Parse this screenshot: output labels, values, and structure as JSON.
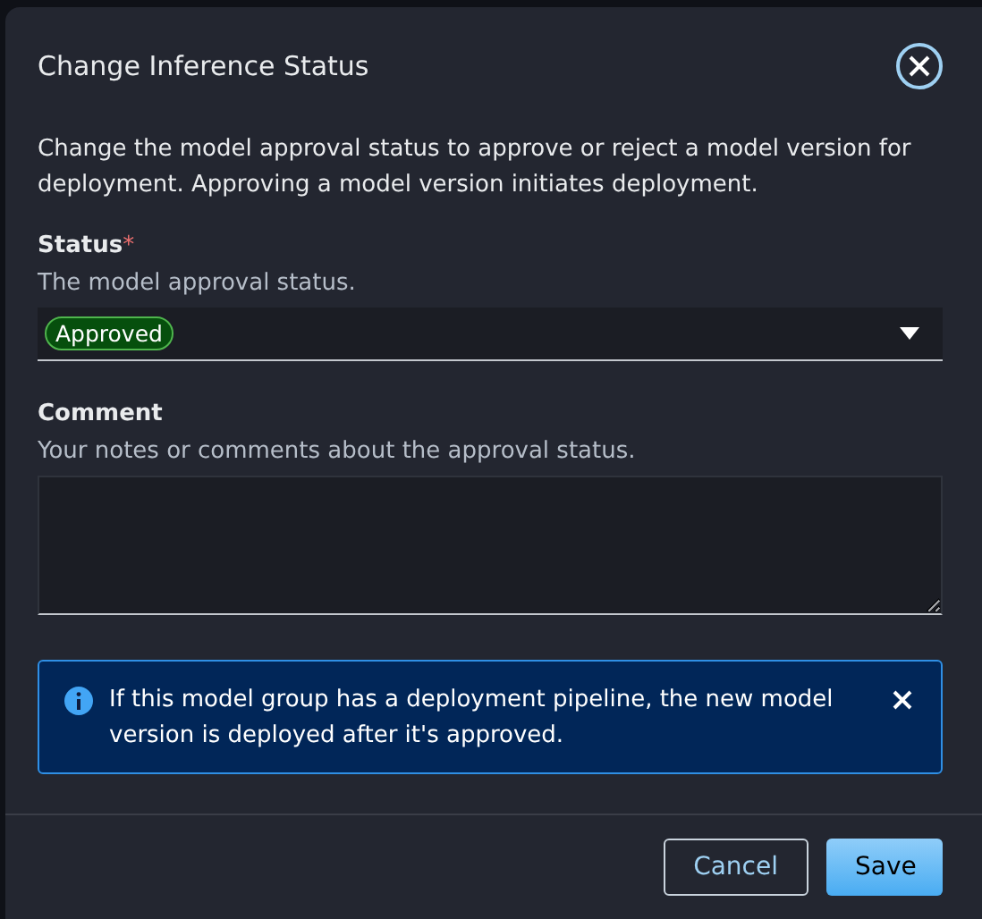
{
  "dialog": {
    "title": "Change Inference Status",
    "description": "Change the model approval status to approve or reject a model version for deployment. Approving a model version initiates deployment.",
    "status_field": {
      "label": "Status",
      "required_mark": "*",
      "description": "The model approval status.",
      "value": "Approved"
    },
    "comment_field": {
      "label": "Comment",
      "description": "Your notes or comments about the approval status."
    },
    "alert": {
      "kind": "info",
      "text": "If this model group has a deployment pipeline, the new model version is deployed after it's approved."
    },
    "buttons": [
      {
        "label": "Cancel",
        "kind": "secondary"
      },
      {
        "label": "Save",
        "kind": "primary"
      }
    ]
  }
}
